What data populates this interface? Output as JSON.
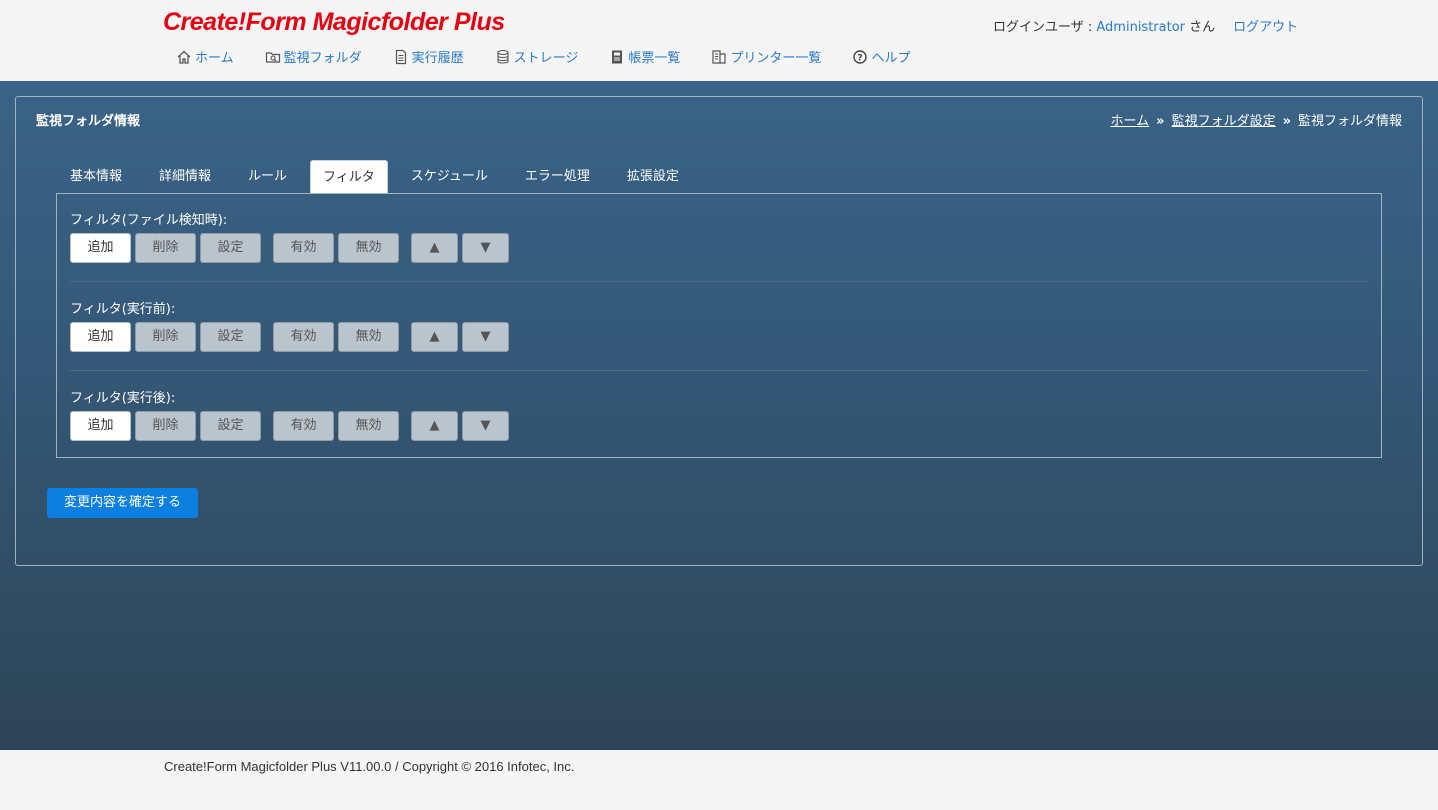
{
  "header": {
    "logo": "Create!Form Magicfolder Plus",
    "login_prefix": "ログインユーザ : ",
    "user": "Administrator",
    "user_suffix": " さん",
    "logout": "ログアウト"
  },
  "nav": [
    {
      "label": "ホーム",
      "icon": "home-icon"
    },
    {
      "label": "監視フォルダ",
      "icon": "folder-search-icon"
    },
    {
      "label": "実行履歴",
      "icon": "document-icon"
    },
    {
      "label": "ストレージ",
      "icon": "database-icon"
    },
    {
      "label": "帳票一覧",
      "icon": "book-icon"
    },
    {
      "label": "プリンター一覧",
      "icon": "printer-icon"
    },
    {
      "label": "ヘルプ",
      "icon": "help-circle-icon"
    }
  ],
  "panel": {
    "title": "監視フォルダ情報",
    "breadcrumb": [
      "ホーム",
      "監視フォルダ設定",
      "監視フォルダ情報"
    ],
    "breadcrumb_sep": "»"
  },
  "tabs": [
    {
      "label": "基本情報",
      "active": false
    },
    {
      "label": "詳細情報",
      "active": false
    },
    {
      "label": "ルール",
      "active": false
    },
    {
      "label": "フィルタ",
      "active": true
    },
    {
      "label": "スケジュール",
      "active": false
    },
    {
      "label": "エラー処理",
      "active": false
    },
    {
      "label": "拡張設定",
      "active": false
    }
  ],
  "sections": [
    {
      "label": "フィルタ(ファイル検知時):"
    },
    {
      "label": "フィルタ(実行前):"
    },
    {
      "label": "フィルタ(実行後):"
    }
  ],
  "buttons": {
    "add": "追加",
    "delete": "削除",
    "settings": "設定",
    "enable": "有効",
    "disable": "無効",
    "up": "▲",
    "down": "▼"
  },
  "confirm": "変更内容を確定する",
  "footer": "Create!Form Magicfolder Plus V11.00.0 / Copyright © 2016 Infotec, Inc."
}
